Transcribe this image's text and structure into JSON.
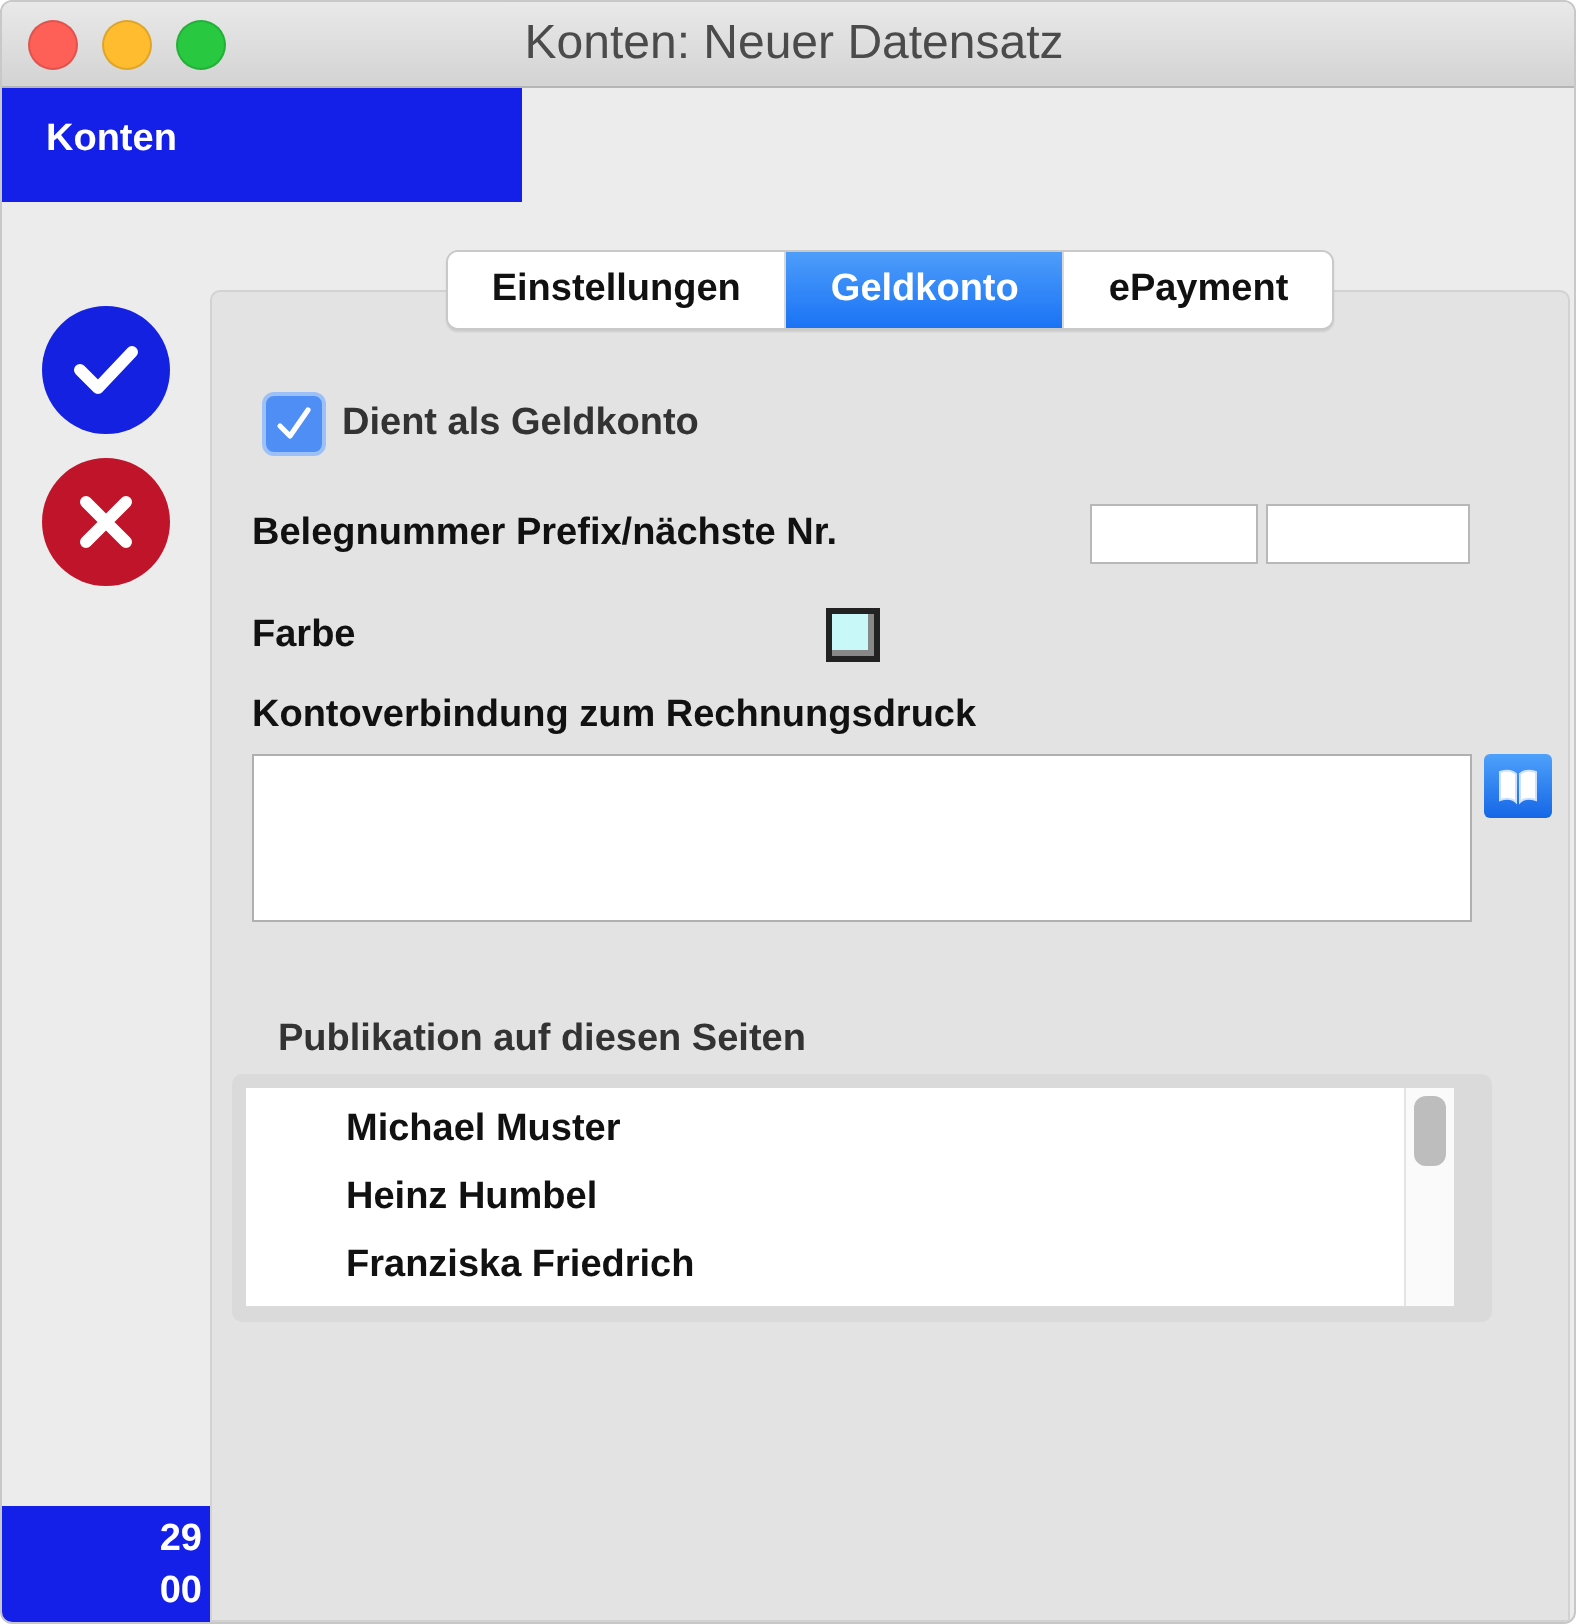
{
  "window": {
    "title": "Konten: Neuer Datensatz"
  },
  "header": {
    "title": "Konten"
  },
  "actions": [
    {
      "kind": "confirm"
    },
    {
      "kind": "cancel"
    }
  ],
  "counter": [
    "29",
    "00"
  ],
  "tabs": [
    {
      "label": "Einstellungen",
      "selected": false
    },
    {
      "label": "Geldkonto",
      "selected": true
    },
    {
      "label": "ePayment",
      "selected": false
    }
  ],
  "money_account": {
    "label": "Dient als Geldkonto",
    "checked": true
  },
  "receipt_number": {
    "label": "Belegnummer Prefix/nächste Nr."
  },
  "color_field": {
    "label": "Farbe",
    "color": "#c9f8f8"
  },
  "bank_details": {
    "label": "Kontoverbindung zum Rechnungsdruck"
  },
  "publication": {
    "label": "Publikation auf diesen Seiten",
    "items": [
      {
        "label": "Michael Muster"
      },
      {
        "label": "Heinz Humbel"
      },
      {
        "label": "Franziska Friedrich"
      }
    ]
  }
}
